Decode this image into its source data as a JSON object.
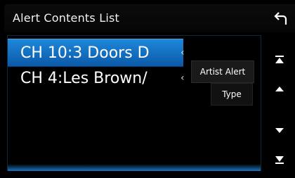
{
  "header": {
    "title": "Alert Contents List",
    "back_icon": "back-arrow-icon"
  },
  "list": {
    "items": [
      {
        "label": "CH 10:3 Doors D",
        "chevron": "‹",
        "selected": true
      },
      {
        "label": "CH 4:Les Brown/",
        "chevron": "‹",
        "selected": false
      }
    ]
  },
  "popup": {
    "artist_alert": "Artist Alert",
    "type": "Type"
  },
  "scroll": {
    "top_icon": "scroll-to-top-icon",
    "up_icon": "scroll-up-icon",
    "down_icon": "scroll-down-icon",
    "bottom_icon": "scroll-to-bottom-icon"
  },
  "colors": {
    "selection": "#1577cc",
    "background": "#000000",
    "text": "#ffffff"
  }
}
